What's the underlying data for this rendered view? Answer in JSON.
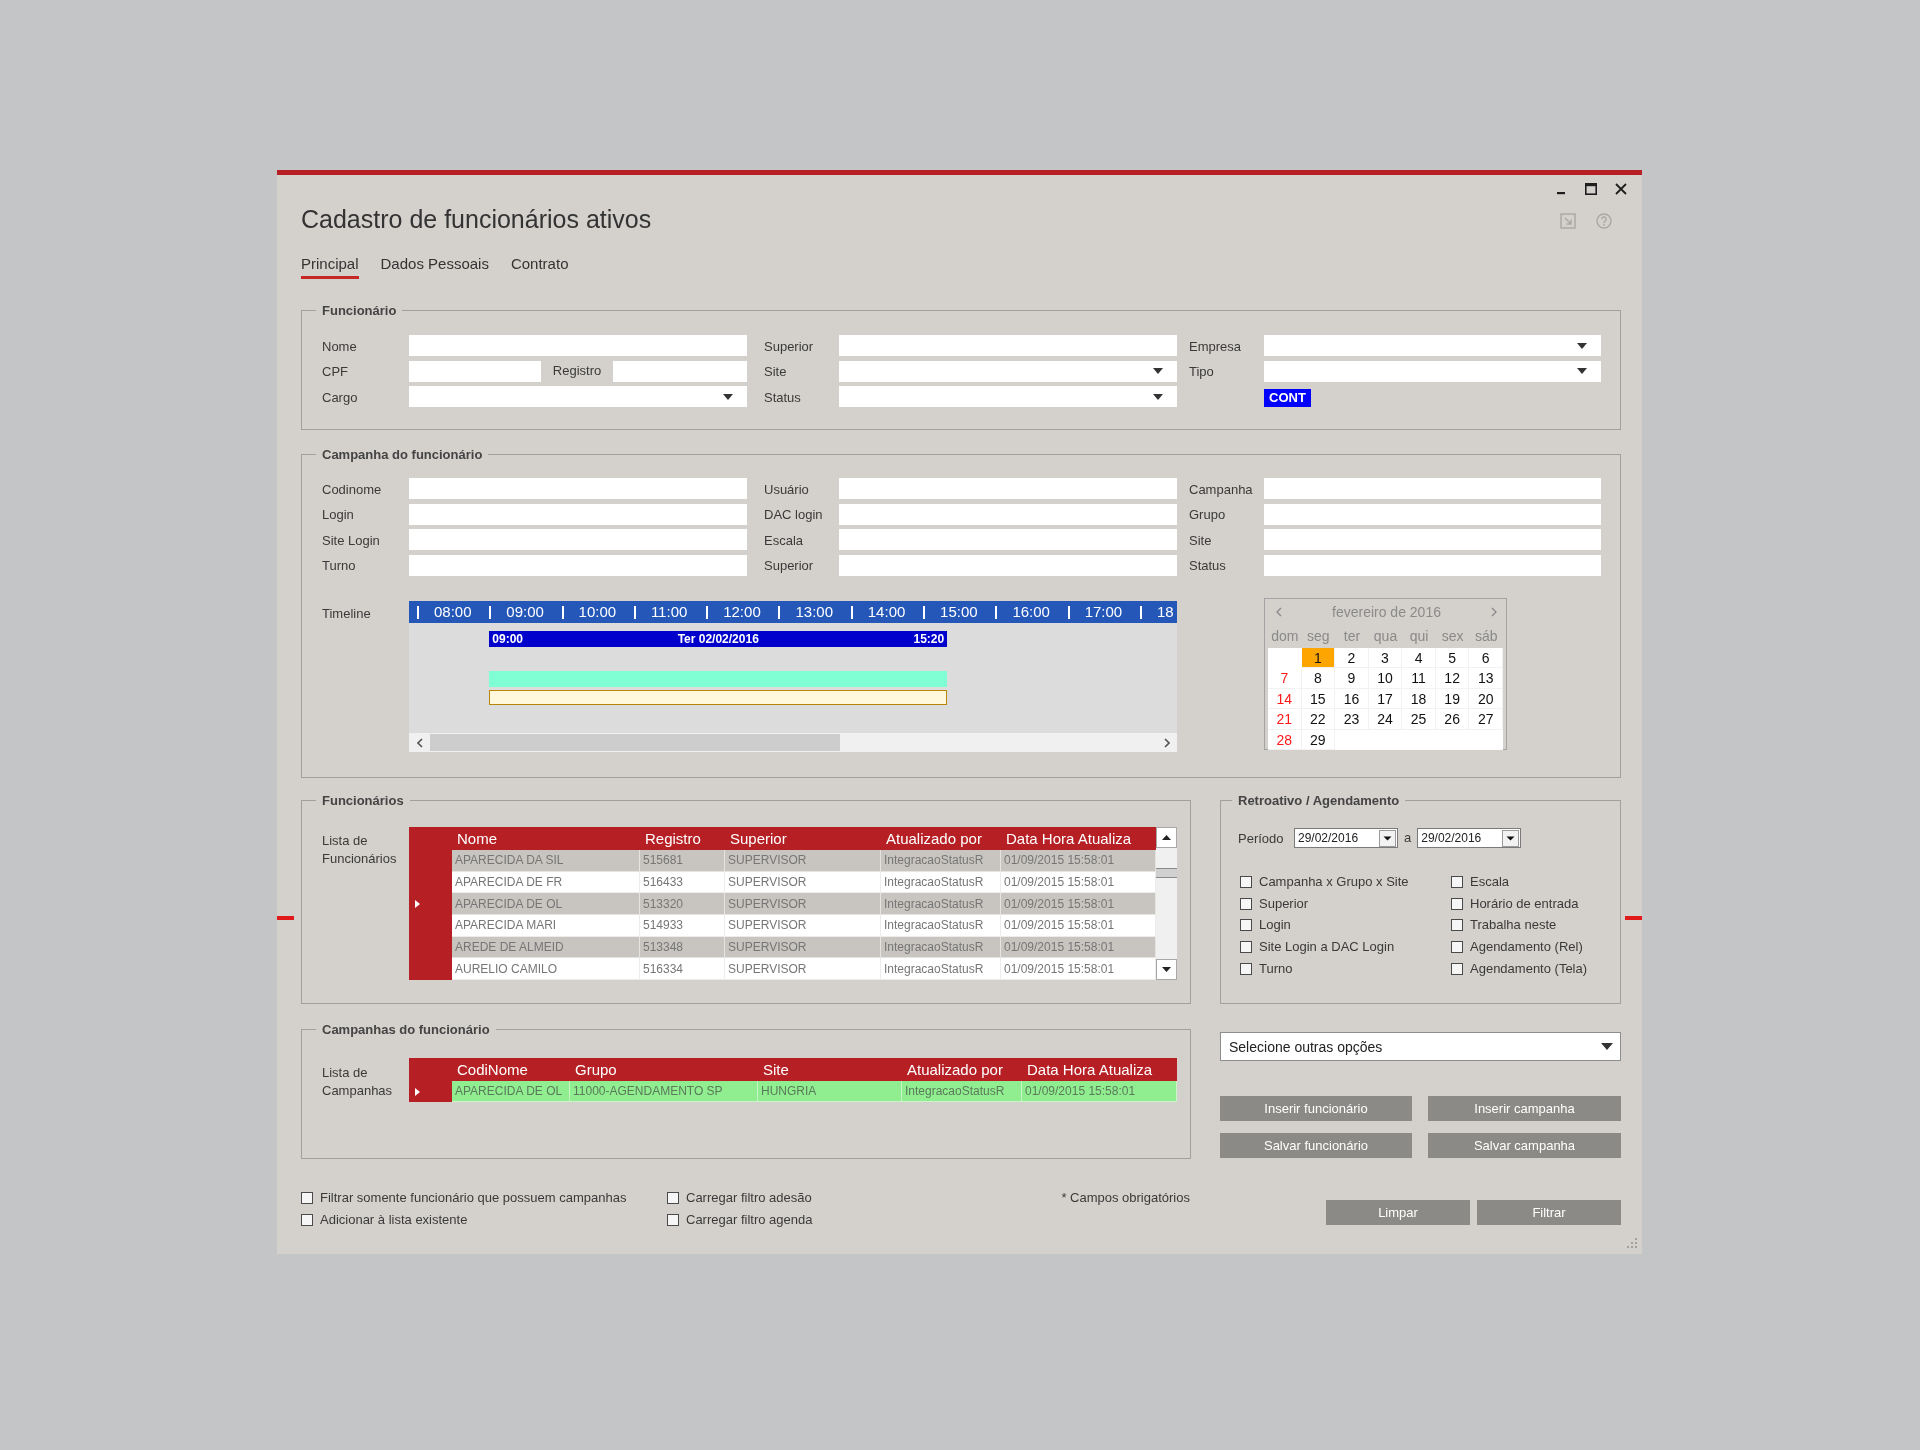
{
  "window": {
    "title": "Cadastro de funcionários ativos"
  },
  "tabs": [
    {
      "label": "Principal",
      "selected": true
    },
    {
      "label": "Dados Pessoais",
      "selected": false
    },
    {
      "label": "Contrato",
      "selected": false
    }
  ],
  "funcionario": {
    "title": "Funcionário",
    "rows": [
      [
        {
          "label": "Nome",
          "kind": "text"
        },
        {
          "label": "Superior",
          "kind": "text"
        },
        {
          "label": "Empresa",
          "kind": "dropdown"
        }
      ],
      [
        {
          "label": "CPF",
          "kind": "split",
          "second_label": "Registro"
        },
        {
          "label": "Site",
          "kind": "dropdown"
        },
        {
          "label": "Tipo",
          "kind": "dropdown"
        }
      ],
      [
        {
          "label": "Cargo",
          "kind": "dropdown"
        },
        {
          "label": "Status",
          "kind": "dropdown"
        },
        {
          "kind": "badge",
          "text": "CONT"
        }
      ]
    ]
  },
  "campanha": {
    "title": "Campanha do funcionário",
    "rows": [
      [
        {
          "label": "Codinome",
          "kind": "text"
        },
        {
          "label": "Usuário",
          "kind": "text"
        },
        {
          "label": "Campanha",
          "kind": "text"
        }
      ],
      [
        {
          "label": "Login",
          "kind": "text"
        },
        {
          "label": "DAC login",
          "kind": "text"
        },
        {
          "label": "Grupo",
          "kind": "text"
        }
      ],
      [
        {
          "label": "Site Login",
          "kind": "text"
        },
        {
          "label": "Escala",
          "kind": "text"
        },
        {
          "label": "Site",
          "kind": "text"
        }
      ],
      [
        {
          "label": "Turno",
          "kind": "text"
        },
        {
          "label": "Superior",
          "kind": "text"
        },
        {
          "label": "Status",
          "kind": "text"
        }
      ]
    ],
    "timeline": {
      "label": "Timeline",
      "hours": [
        "08:00",
        "09:00",
        "10:00",
        "11:00",
        "12:00",
        "13:00",
        "14:00",
        "15:00",
        "16:00",
        "17:00",
        "18"
      ],
      "event": {
        "start": "09:00",
        "date": "Ter 02/02/2016",
        "end": "15:20"
      }
    },
    "calendar": {
      "title": "fevereiro de 2016",
      "weekdays": [
        "dom",
        "seg",
        "ter",
        "qua",
        "qui",
        "sex",
        "sáb"
      ],
      "weeks": [
        [
          {
            "day": "1",
            "selected": true
          },
          {
            "day": "2",
            "selected": false
          },
          {
            "day": "3",
            "selected": false
          },
          {
            "day": "4",
            "selected": false
          },
          {
            "day": "5",
            "selected": false
          },
          {
            "day": "6",
            "selected": false
          }
        ],
        [
          {
            "day": "7",
            "selected": false
          },
          {
            "day": "8",
            "selected": false
          },
          {
            "day": "9",
            "selected": false
          },
          {
            "day": "10",
            "selected": false
          },
          {
            "day": "11",
            "selected": false
          },
          {
            "day": "12",
            "selected": false
          },
          {
            "day": "13",
            "selected": false
          }
        ],
        [
          {
            "day": "14",
            "selected": false
          },
          {
            "day": "15",
            "selected": false
          },
          {
            "day": "16",
            "selected": false
          },
          {
            "day": "17",
            "selected": false
          },
          {
            "day": "18",
            "selected": false
          },
          {
            "day": "19",
            "selected": false
          },
          {
            "day": "20",
            "selected": false
          }
        ],
        [
          {
            "day": "21",
            "selected": false
          },
          {
            "day": "22",
            "selected": false
          },
          {
            "day": "23",
            "selected": false
          },
          {
            "day": "24",
            "selected": false
          },
          {
            "day": "25",
            "selected": false
          },
          {
            "day": "26",
            "selected": false
          },
          {
            "day": "27",
            "selected": false
          }
        ],
        [
          {
            "day": "28",
            "selected": false
          },
          {
            "day": "29",
            "selected": false
          }
        ]
      ]
    }
  },
  "funcionarios": {
    "title": "Funcionários",
    "list_label": "Lista de Funcionários",
    "columns": [
      "Nome",
      "Registro",
      "Superior",
      "Atualizado por",
      "Data Hora Atualiza"
    ],
    "rows": [
      {
        "cells": [
          "APARECIDA DA SIL",
          "515681",
          "SUPERVISOR",
          "IntegracaoStatusR",
          "01/09/2015 15:58:01"
        ],
        "selected": false
      },
      {
        "cells": [
          "APARECIDA DE FR",
          "516433",
          "SUPERVISOR",
          "IntegracaoStatusR",
          "01/09/2015 15:58:01"
        ],
        "selected": false
      },
      {
        "cells": [
          "APARECIDA DE OL",
          "513320",
          "SUPERVISOR",
          "IntegracaoStatusR",
          "01/09/2015 15:58:01"
        ],
        "selected": true
      },
      {
        "cells": [
          "APARECIDA MARI",
          "514933",
          "SUPERVISOR",
          "IntegracaoStatusR",
          "01/09/2015 15:58:01"
        ],
        "selected": false
      },
      {
        "cells": [
          "AREDE DE ALMEID",
          "513348",
          "SUPERVISOR",
          "IntegracaoStatusR",
          "01/09/2015 15:58:01"
        ],
        "selected": false
      },
      {
        "cells": [
          "AURELIO CAMILO",
          "516334",
          "SUPERVISOR",
          "IntegracaoStatusR",
          "01/09/2015 15:58:01"
        ],
        "selected": false
      }
    ]
  },
  "retroativo": {
    "title": "Retroativo / Agendamento",
    "period_label": "Período",
    "from": "29/02/2016",
    "separator": "a",
    "to": "29/02/2016",
    "options": [
      {
        "label": "Campanha x Grupo x Site",
        "checked": false
      },
      {
        "label": "Superior",
        "checked": false
      },
      {
        "label": "Login",
        "checked": false
      },
      {
        "label": "Site Login a DAC Login",
        "checked": false
      },
      {
        "label": "Turno",
        "checked": false
      },
      {
        "label": "Escala",
        "checked": false
      },
      {
        "label": "Horário de entrada",
        "checked": false
      },
      {
        "label": "Trabalha neste",
        "checked": false
      },
      {
        "label": "Agendamento (Rel)",
        "checked": false
      },
      {
        "label": "Agendamento (Tela)",
        "checked": false
      }
    ]
  },
  "campanhas": {
    "title": "Campanhas do funcionário",
    "list_label": "Lista de Campanhas",
    "columns": [
      "CodiNome",
      "Grupo",
      "Site",
      "Atualizado por",
      "Data Hora Atualiza"
    ],
    "rows": [
      {
        "cells": [
          "APARECIDA DE OL",
          "11000-AGENDAMENTO SP",
          "HUNGRIA",
          "IntegracaoStatusR",
          "01/09/2015 15:58:01"
        ],
        "selected": true
      }
    ]
  },
  "other_options": {
    "placeholder": "Selecione outras opções"
  },
  "actions": [
    "Inserir funcionário",
    "Inserir campanha",
    "Salvar funcionário",
    "Salvar campanha"
  ],
  "filters": [
    {
      "label": "Filtrar somente funcionário que possuem campanhas",
      "checked": false
    },
    {
      "label": "Adicionar à lista existente",
      "checked": false
    },
    {
      "label": "Carregar filtro adesão",
      "checked": false
    },
    {
      "label": "Carregar filtro agenda",
      "checked": false
    }
  ],
  "required_note": "* Campos obrigatórios",
  "footer_buttons": [
    "Limpar",
    "Filtrar"
  ]
}
